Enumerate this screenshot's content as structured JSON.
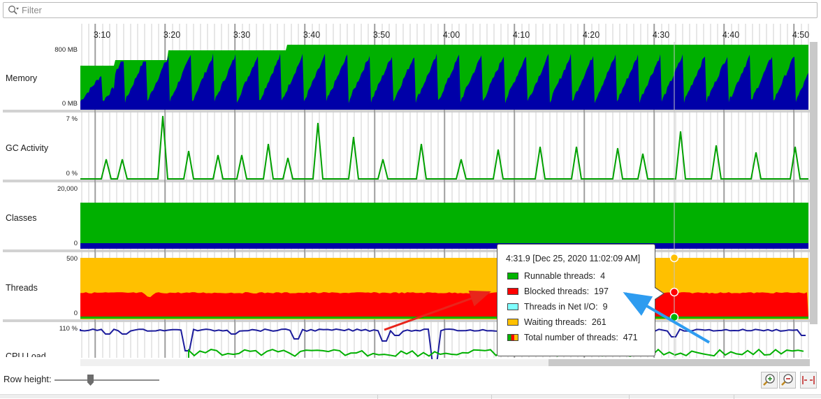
{
  "filter": {
    "placeholder": "Filter",
    "value": ""
  },
  "time_axis": {
    "labels": [
      "3:10",
      "3:20",
      "3:30",
      "3:40",
      "3:50",
      "4:00",
      "4:10",
      "4:20",
      "4:30",
      "4:40",
      "4:50"
    ]
  },
  "rows": {
    "memory": {
      "label": "Memory",
      "scale_max": "800 MB",
      "scale_min": "0 MB"
    },
    "gc": {
      "label": "GC Activity",
      "scale_max": "7 %",
      "scale_min": "0 %"
    },
    "classes": {
      "label": "Classes",
      "scale_max": "20,000",
      "scale_min": "0"
    },
    "threads": {
      "label": "Threads",
      "scale_max": "500",
      "scale_min": "0"
    },
    "cpu": {
      "label": "CPU Load",
      "scale_max": "110 %"
    }
  },
  "tooltip": {
    "title": "4:31.9 [Dec 25, 2020 11:02:09 AM]",
    "items": [
      {
        "label": "Runnable threads:",
        "value": "4",
        "color": "#00b400"
      },
      {
        "label": "Blocked threads:",
        "value": "197",
        "color": "#ff0000"
      },
      {
        "label": "Threads in Net I/O:",
        "value": "9",
        "color": "#7fffff"
      },
      {
        "label": "Waiting threads:",
        "value": "261",
        "color": "#ffc000"
      },
      {
        "label": "Total number of threads:",
        "value": "471",
        "color": "#f0c000"
      }
    ]
  },
  "bottom": {
    "row_height_label": "Row height:"
  },
  "colors": {
    "memory_used": "#0000a8",
    "memory_free": "#00b000",
    "gc_line": "#00a000",
    "threads_waiting": "#ffc000",
    "threads_blocked": "#ff0000",
    "threads_runnable": "#00b400",
    "cpu_main": "#1c1c9c",
    "cpu_gc": "#00b000",
    "annotation_red": "#e8251b",
    "annotation_blue": "#2e9cf0"
  },
  "icons": [
    "search-icon",
    "zoom-in-icon",
    "zoom-out-icon",
    "fit-width-icon"
  ]
}
